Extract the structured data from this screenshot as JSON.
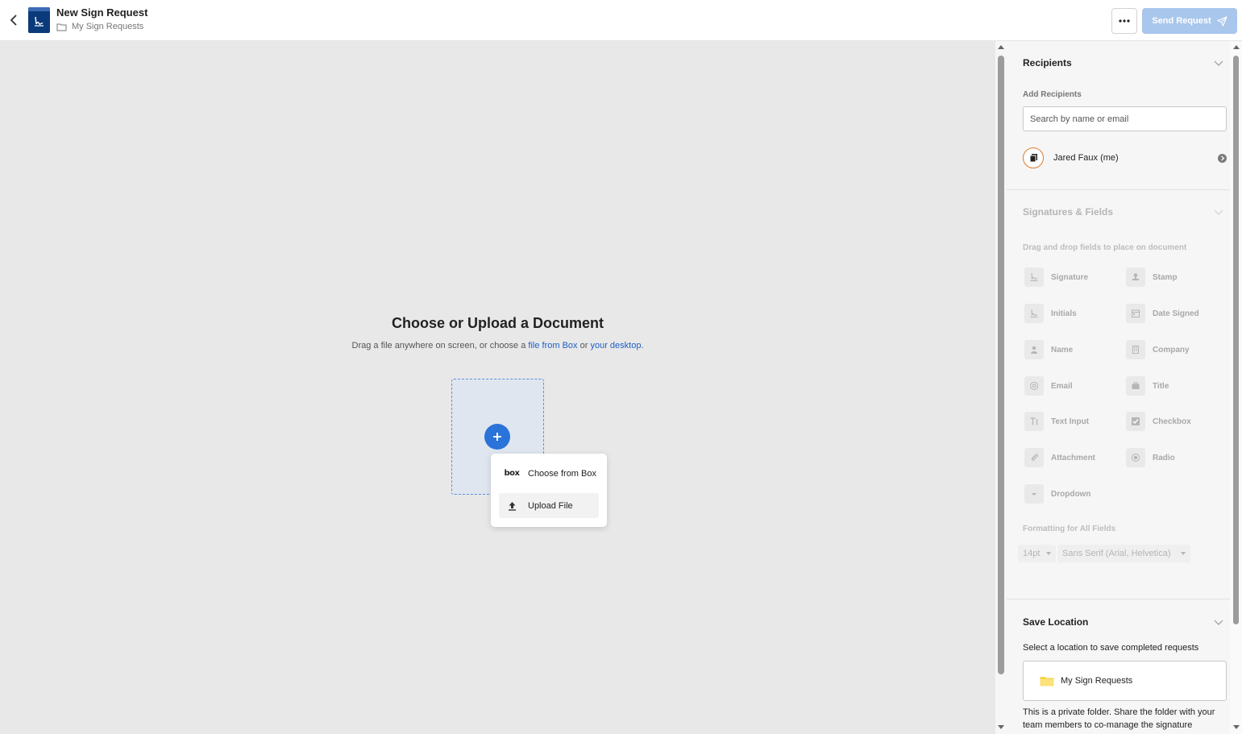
{
  "header": {
    "title": "New Sign Request",
    "breadcrumb": "My Sign Requests",
    "more_label": "...",
    "send_label": "Send Request"
  },
  "main": {
    "heading": "Choose or Upload a Document",
    "sub_prefix": "Drag a file anywhere on screen, or choose a",
    "link_box": "file from Box",
    "sub_or": "or",
    "link_desktop": "your desktop",
    "sub_end": ".",
    "menu": [
      {
        "label": "Choose from Box",
        "icon": "box-logo"
      },
      {
        "label": "Upload File",
        "icon": "upload-icon"
      }
    ],
    "box_logo_text": "box"
  },
  "sidebar": {
    "recipients": {
      "title": "Recipients",
      "add_label": "Add Recipients",
      "search_placeholder": "Search by name or email",
      "recipient_name": "Jared Faux (me)"
    },
    "fields": {
      "title": "Signatures & Fields",
      "hint": "Drag and drop fields to place on document",
      "items": [
        {
          "label": "Signature",
          "icon": "signature-icon"
        },
        {
          "label": "Stamp",
          "icon": "stamp-icon"
        },
        {
          "label": "Initials",
          "icon": "initials-icon"
        },
        {
          "label": "Date Signed",
          "icon": "calendar-icon"
        },
        {
          "label": "Name",
          "icon": "person-icon"
        },
        {
          "label": "Company",
          "icon": "building-icon"
        },
        {
          "label": "Email",
          "icon": "at-icon"
        },
        {
          "label": "Title",
          "icon": "briefcase-icon"
        },
        {
          "label": "Text Input",
          "icon": "text-icon"
        },
        {
          "label": "Checkbox",
          "icon": "checkbox-icon"
        },
        {
          "label": "Attachment",
          "icon": "paperclip-icon"
        },
        {
          "label": "Radio",
          "icon": "radio-icon"
        },
        {
          "label": "Dropdown",
          "icon": "dropdown-icon"
        }
      ],
      "format_label": "Formatting for All Fields",
      "font_size": "14pt",
      "font_family": "Sans Serif (Arial, Helvetica)"
    },
    "save": {
      "title": "Save Location",
      "description": "Select a location to save completed requests",
      "folder": "My Sign Requests",
      "note": "This is a private folder. Share the folder with your team members to co-manage the signature"
    }
  },
  "colors": {
    "accent": "#2a73d9",
    "send_disabled": "#a9c6ec",
    "app_icon": "#0b3a7a",
    "avatar_ring": "#e07b2f"
  }
}
